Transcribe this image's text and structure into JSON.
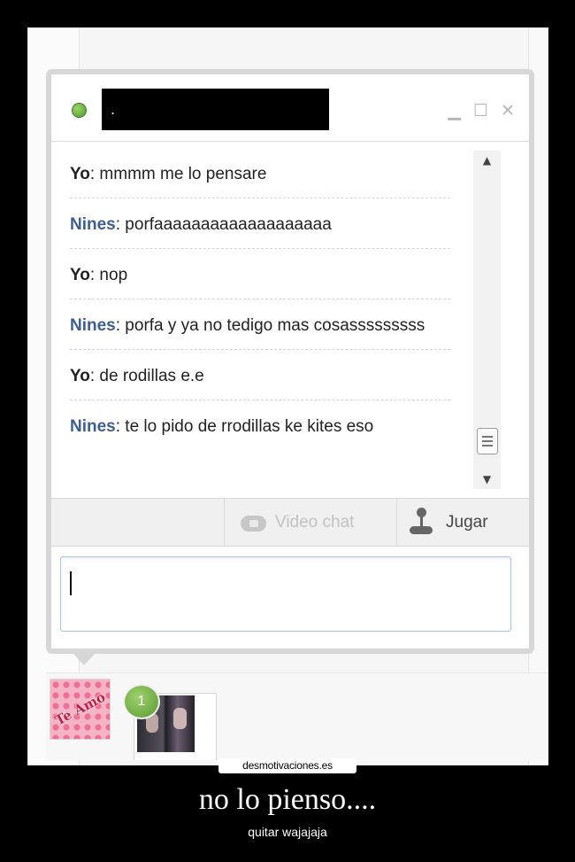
{
  "chat": {
    "contact_name": ".",
    "window_controls": {
      "minimize": "▁",
      "maximize": "☐",
      "close": "✕"
    },
    "messages": [
      {
        "sender": "Yo",
        "text": ": mmmm me lo pensare"
      },
      {
        "sender": "Nines",
        "text": ": porfaaaaaaaaaaaaaaaaaaa"
      },
      {
        "sender": "Yo",
        "text": ": nop"
      },
      {
        "sender": "Nines",
        "text": ": porfa y ya no tedigo mas cosasssssssss"
      },
      {
        "sender": "Yo",
        "text": ": de rodillas e.e"
      },
      {
        "sender": "Nines",
        "text": ": te lo pido de rrodillas ke kites eso"
      }
    ],
    "actions": {
      "video_chat": "Video chat",
      "jugar": "Jugar"
    },
    "input_value": "",
    "tray": {
      "teamo_text": "Te Amo",
      "badge_count": "1"
    }
  },
  "caption": {
    "site": "desmotivaciones.es",
    "title": "no lo pienso....",
    "subtitle": "quitar wajajaja"
  },
  "colors": {
    "status_online": "#5fa83a",
    "sender_other": "#3d5f8f",
    "input_border": "#a9c4e0"
  }
}
